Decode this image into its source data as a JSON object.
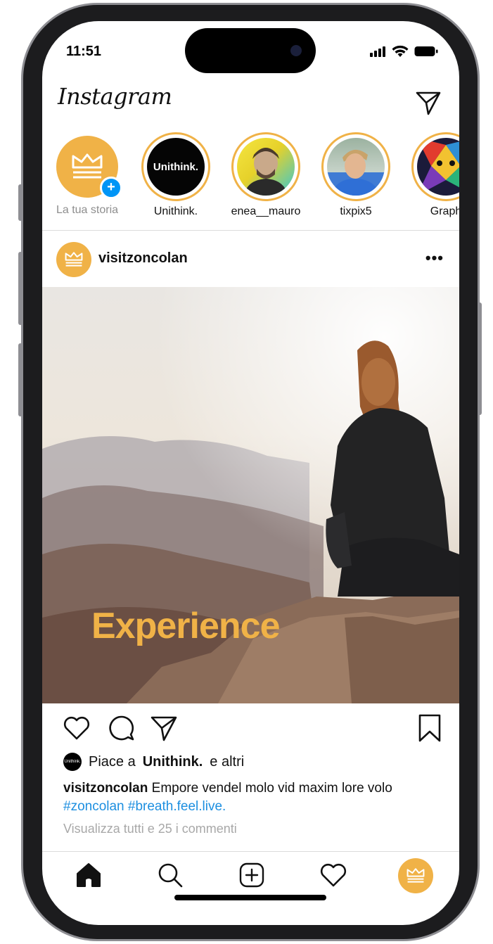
{
  "status_bar": {
    "time": "11:51"
  },
  "header": {
    "logo_text": "Instagram"
  },
  "stories": [
    {
      "label": "La tua storia",
      "kind": "own"
    },
    {
      "label": "Unithink.",
      "avatar_text": "Unithink.",
      "kind": "brand"
    },
    {
      "label": "enea__mauro",
      "kind": "photo"
    },
    {
      "label": "tixpix5",
      "kind": "photo"
    },
    {
      "label": "Graph",
      "kind": "photo"
    }
  ],
  "post": {
    "username": "visitzoncolan",
    "more_label": "•••",
    "overlay_text": "Experience",
    "likes": {
      "prefix": "Piace a",
      "user": "Unithink.",
      "suffix": "e altri",
      "avatar_text": "Unithink."
    },
    "caption": {
      "user": "visitzoncolan",
      "text": "Empore vendel molo vid maxim lore volo",
      "hashtags": "#zoncolan #breath.feel.live."
    },
    "comments_link": "Visualizza tutti e 25 i commenti"
  },
  "nav": {
    "items": [
      "home-icon",
      "search-icon",
      "create-icon",
      "activity-icon",
      "profile-avatar"
    ]
  },
  "colors": {
    "accent": "#f0b247",
    "link": "#1d8fe0",
    "muted": "#8e8e8e"
  }
}
